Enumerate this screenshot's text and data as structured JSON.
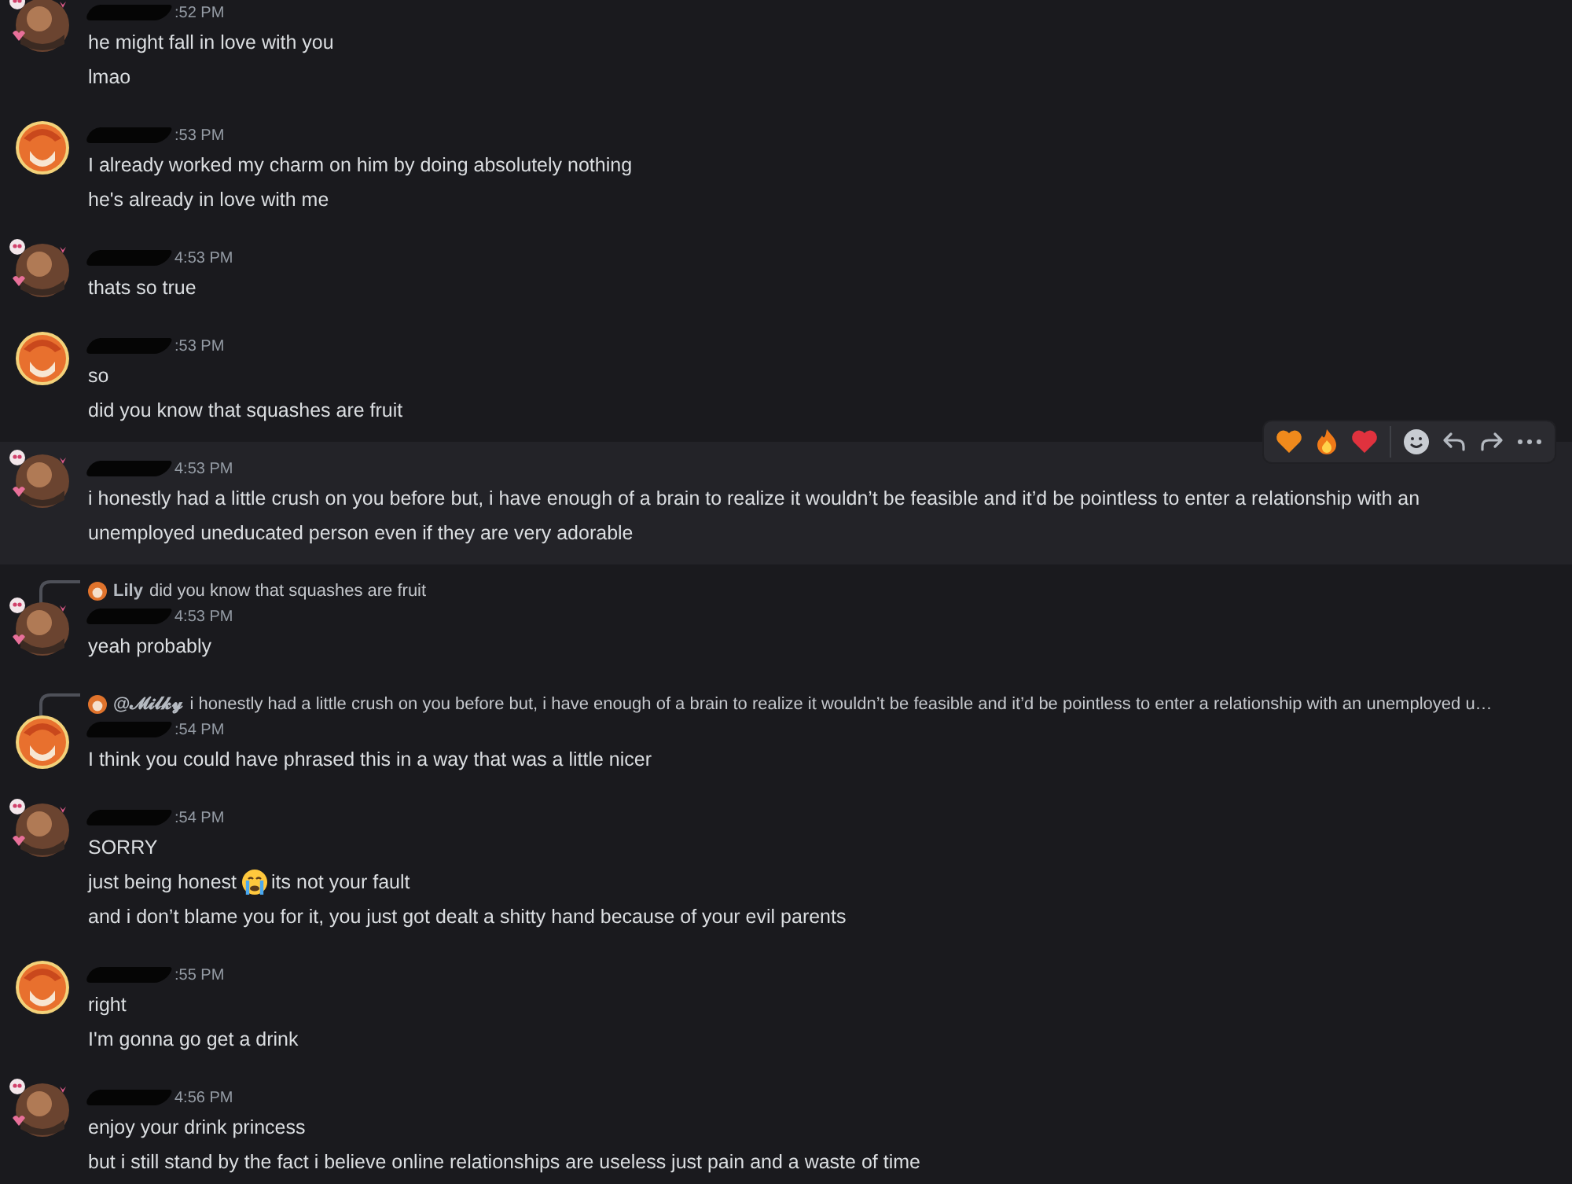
{
  "messages": [
    {
      "kind": "decorated",
      "time": ":52 PM",
      "highlighted": false,
      "lines": [
        "he might fall in love with you",
        "lmao"
      ]
    },
    {
      "kind": "round",
      "time": ":53 PM",
      "highlighted": false,
      "lines": [
        "I already worked my charm on him by doing absolutely nothing",
        "he's already in love with me"
      ]
    },
    {
      "kind": "decorated",
      "time": "4:53 PM",
      "highlighted": false,
      "lines": [
        "thats so true"
      ]
    },
    {
      "kind": "round",
      "time": ":53 PM",
      "highlighted": false,
      "lines": [
        "so",
        "did you know that squashes are fruit"
      ]
    },
    {
      "kind": "decorated",
      "time": "4:53 PM",
      "highlighted": true,
      "lines": [
        "i honestly had a little crush on you before but, i have enough of a brain to realize it wouldn’t be feasible and it’d be pointless to enter a relationship with an unemployed uneducated person even if they are very adorable"
      ]
    },
    {
      "kind": "decorated",
      "time": "4:53 PM",
      "highlighted": false,
      "reply": {
        "author": "Lily",
        "text": "did you know that squashes are fruit"
      },
      "lines": [
        "yeah probably"
      ]
    },
    {
      "kind": "round",
      "time": ":54 PM",
      "highlighted": false,
      "reply": {
        "author": "@𝓜𝓲𝓵𝓴𝔂",
        "text": "i honestly had a little crush on you before but, i have enough of a brain to realize it wouldn’t be feasible and it’d be pointless to enter a relationship with an unemployed u…"
      },
      "lines": [
        "I think you could have phrased this in a way that was a little nicer"
      ]
    },
    {
      "kind": "decorated",
      "time": ":54 PM",
      "highlighted": false,
      "lines": [
        "SORRY",
        [
          "just being honest",
          "its not your fault"
        ],
        "and i don’t blame you for it, you just got dealt a shitty hand because of your evil parents"
      ]
    },
    {
      "kind": "round",
      "time": ":55 PM",
      "highlighted": false,
      "lines": [
        "right",
        "I'm gonna go get a drink"
      ]
    },
    {
      "kind": "decorated",
      "time": "4:56 PM",
      "highlighted": false,
      "lines": [
        "enjoy your drink princess",
        "but i still stand by the fact i believe online relationships are useless just pain and a waste of time"
      ]
    }
  ]
}
